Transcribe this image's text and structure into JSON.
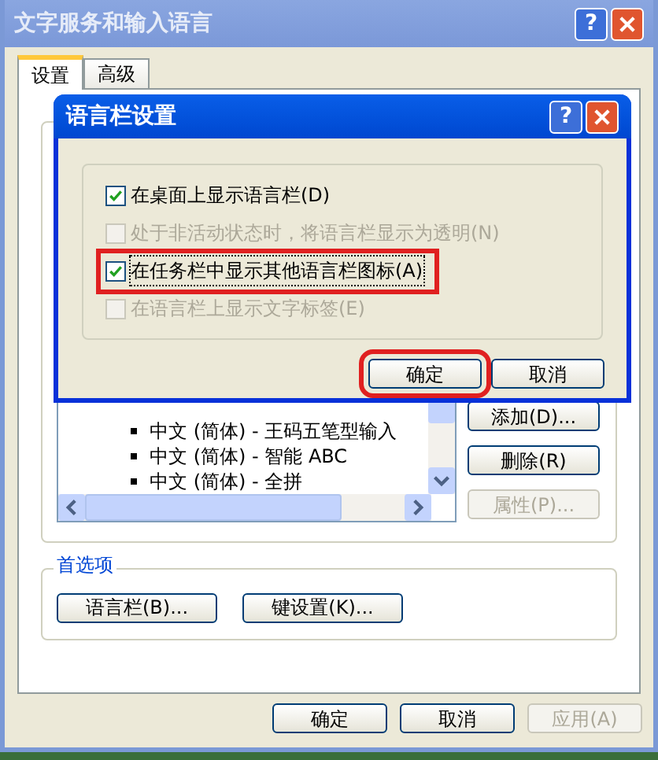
{
  "window": {
    "title": "文字服务和输入语言",
    "help_glyph": "?"
  },
  "tabs": [
    {
      "label": "设置",
      "selected": true
    },
    {
      "label": "高级",
      "selected": false
    }
  ],
  "installed_services": {
    "items": [
      "中文 (简体) - 王码五笔型输入",
      "中文 (简体) - 智能 ABC",
      "中文 (简体) - 全拼"
    ],
    "buttons": [
      {
        "label": "添加(D)...",
        "disabled": false
      },
      {
        "label": "删除(R)",
        "disabled": false
      },
      {
        "label": "属性(P)...",
        "disabled": true
      }
    ]
  },
  "preferences": {
    "title": "首选项",
    "buttons": [
      "语言栏(B)...",
      "键设置(K)..."
    ]
  },
  "footer_buttons": [
    {
      "label": "确定",
      "disabled": false
    },
    {
      "label": "取消",
      "disabled": false
    },
    {
      "label": "应用(A)",
      "disabled": true
    }
  ],
  "dialog": {
    "title": "语言栏设置",
    "help_glyph": "?",
    "options": [
      {
        "label": "在桌面上显示语言栏(D)",
        "checked": true,
        "disabled": false,
        "highlighted": false
      },
      {
        "label": "处于非活动状态时，将语言栏显示为透明(N)",
        "checked": false,
        "disabled": true,
        "highlighted": false
      },
      {
        "label": "在任务栏中显示其他语言栏图标(A)",
        "checked": true,
        "disabled": false,
        "highlighted": true
      },
      {
        "label": "在语言栏上显示文字标签(E)",
        "checked": false,
        "disabled": true,
        "highlighted": false
      }
    ],
    "buttons": [
      {
        "label": "确定",
        "highlighted": true
      },
      {
        "label": "取消",
        "highlighted": false
      }
    ]
  }
}
